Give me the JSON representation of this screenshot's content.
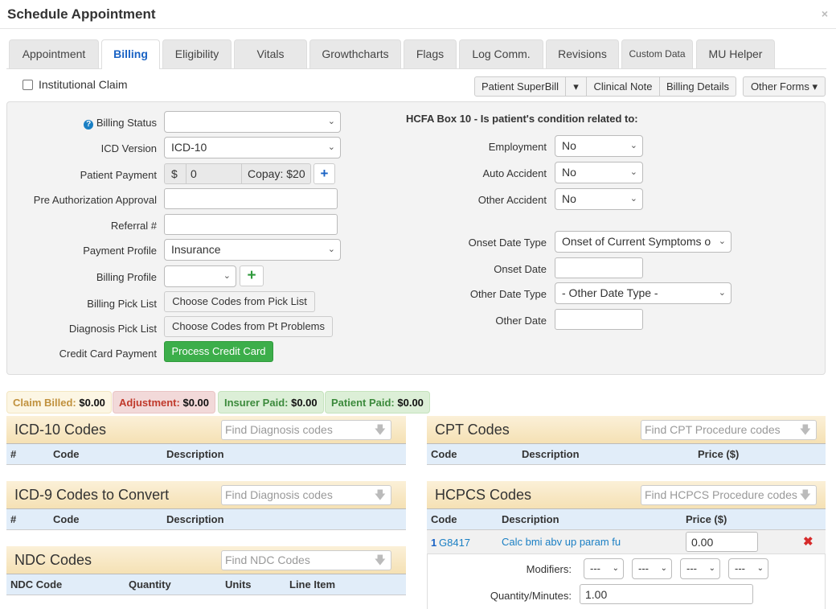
{
  "window": {
    "title": "Schedule Appointment",
    "close_icon": "×"
  },
  "tabs": [
    "Appointment",
    "Billing",
    "Eligibility",
    "Vitals",
    "Growthcharts",
    "Flags",
    "Log Comm.",
    "Revisions",
    "Custom Data",
    "MU Helper"
  ],
  "active_tab": "Billing",
  "institutional_claim": {
    "label": "Institutional Claim",
    "checked": false
  },
  "toolbar": {
    "superbill": "Patient SuperBill",
    "clinical_note": "Clinical Note",
    "billing_details": "Billing Details",
    "other_forms": "Other Forms"
  },
  "left_form": {
    "billing_status": {
      "label": "Billing Status",
      "value": ""
    },
    "icd_version": {
      "label": "ICD Version",
      "value": "ICD-10"
    },
    "patient_payment": {
      "label": "Patient Payment",
      "currency": "$",
      "value": "0",
      "copay": "Copay: $20"
    },
    "pre_auth": {
      "label": "Pre Authorization Approval",
      "value": ""
    },
    "referral": {
      "label": "Referral #",
      "value": ""
    },
    "payment_profile": {
      "label": "Payment Profile",
      "value": "Insurance"
    },
    "billing_profile": {
      "label": "Billing Profile",
      "value": ""
    },
    "billing_pick_list": {
      "label": "Billing Pick List",
      "button": "Choose Codes from Pick List"
    },
    "diagnosis_pick_list": {
      "label": "Diagnosis Pick List",
      "button": "Choose Codes from Pt Problems"
    },
    "credit_card": {
      "label": "Credit Card Payment",
      "button": "Process Credit Card"
    }
  },
  "hcfa": {
    "heading": "HCFA Box 10 - Is patient's condition related to:",
    "employment": {
      "label": "Employment",
      "value": "No"
    },
    "auto_accident": {
      "label": "Auto Accident",
      "value": "No"
    },
    "other_accident": {
      "label": "Other Accident",
      "value": "No"
    },
    "onset_date_type": {
      "label": "Onset Date Type",
      "value": "Onset of Current Symptoms o"
    },
    "onset_date": {
      "label": "Onset Date",
      "value": ""
    },
    "other_date_type": {
      "label": "Other Date Type",
      "value": "- Other Date Type -"
    },
    "other_date": {
      "label": "Other Date",
      "value": ""
    }
  },
  "badges": {
    "claim_billed": {
      "label": "Claim Billed:",
      "value": "$0.00",
      "color": "#c0913e"
    },
    "adjustment": {
      "label": "Adjustment:",
      "value": "$0.00",
      "color": "#c0392b"
    },
    "insurer_paid": {
      "label": "Insurer Paid:",
      "value": "$0.00",
      "color": "#3c8a3c"
    },
    "patient_paid": {
      "label": "Patient Paid:",
      "value": "$0.00",
      "color": "#3c8a3c"
    }
  },
  "icd10": {
    "title": "ICD-10 Codes",
    "placeholder": "Find Diagnosis codes",
    "columns": [
      "#",
      "Code",
      "Description"
    ]
  },
  "icd9": {
    "title": "ICD-9 Codes to Convert",
    "placeholder": "Find Diagnosis codes",
    "columns": [
      "#",
      "Code",
      "Description"
    ]
  },
  "ndc": {
    "title": "NDC Codes",
    "placeholder": "Find NDC Codes",
    "columns": [
      "NDC Code",
      "Quantity",
      "Units",
      "Line Item"
    ]
  },
  "cpt": {
    "title": "CPT Codes",
    "placeholder": "Find CPT Procedure codes",
    "columns": [
      "Code",
      "Description",
      "Price ($)"
    ]
  },
  "hcpcs": {
    "title": "HCPCS Codes",
    "placeholder": "Find HCPCS Procedure codes",
    "columns": [
      "Code",
      "Description",
      "Price ($)"
    ],
    "rows": [
      {
        "num": "1",
        "code": "G8417",
        "description": "Calc bmi abv up param fu",
        "price": "0.00",
        "modifiers_label": "Modifiers:",
        "modifiers": [
          "---",
          "---",
          "---",
          "---"
        ],
        "quantity_label": "Quantity/Minutes:",
        "quantity": "1.00"
      }
    ]
  }
}
